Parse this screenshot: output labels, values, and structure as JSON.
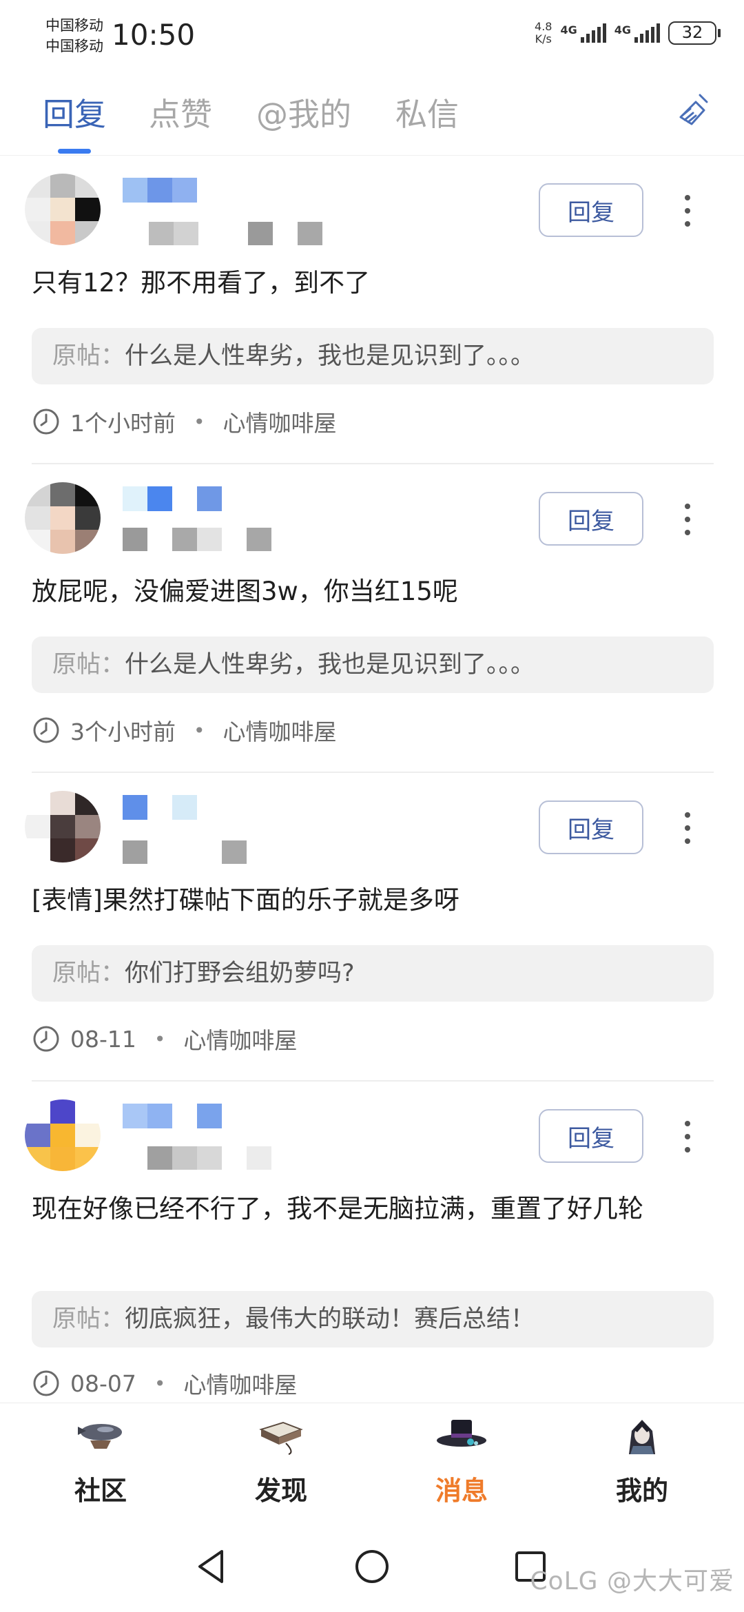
{
  "status_bar": {
    "carrier_1": "中国移动",
    "carrier_2": "中国移动",
    "time": "10:50",
    "net_speed_value": "4.8",
    "net_speed_unit": "K/s",
    "signal_1_label": "4G",
    "signal_2_label": "4G",
    "battery": "32"
  },
  "tabs": {
    "reply": "回复",
    "like": "点赞",
    "mention": "@我的",
    "message": "私信"
  },
  "clear_icon": "broom-icon",
  "reply_button_label": "回复",
  "origin_prefix": "原帖：",
  "separator": "•",
  "items": [
    {
      "content": "只有12？那不用看了，到不了",
      "origin": "什么是人性卑劣，我也是见识到了。。。",
      "time": "1个小时前",
      "forum": "心情咖啡屋"
    },
    {
      "content": "放屁呢，没偏爱进图3w，你当红15呢",
      "origin": "什么是人性卑劣，我也是见识到了。。。",
      "time": "3个小时前",
      "forum": "心情咖啡屋"
    },
    {
      "content": "[表情]果然打碟帖下面的乐子就是多呀",
      "origin": "你们打野会组奶萝吗?",
      "time": "08-11",
      "forum": "心情咖啡屋"
    },
    {
      "content": "现在好像已经不行了，我不是无脑拉满，重置了好几轮",
      "origin": "彻底疯狂，最伟大的联动！赛后总结！",
      "time": "08-07",
      "forum": "心情咖啡屋"
    }
  ],
  "bottom_nav": {
    "community": "社区",
    "discover": "发现",
    "messages": "消息",
    "mine": "我的",
    "active": "messages",
    "active_color": "#ef7b2a"
  },
  "watermark": "CoLG @大大可爱",
  "accent_color": "#3a7bf0"
}
